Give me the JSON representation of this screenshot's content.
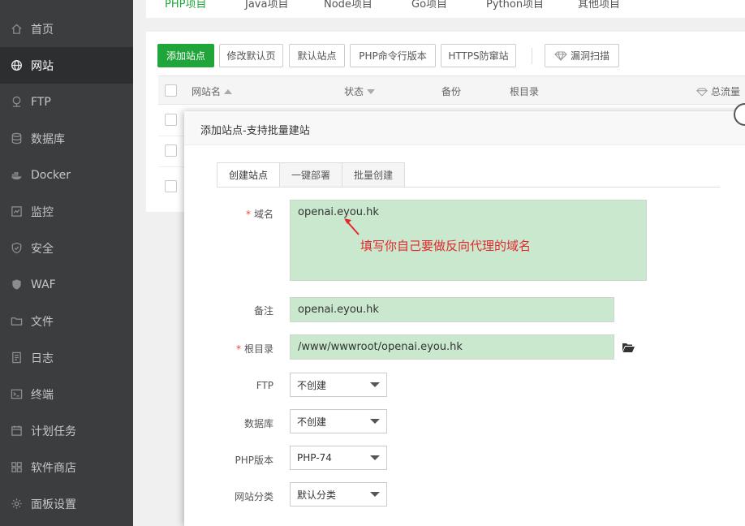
{
  "sidebar": {
    "items": [
      {
        "label": "首页",
        "icon": "home-icon"
      },
      {
        "label": "网站",
        "icon": "globe-icon",
        "active": true
      },
      {
        "label": "FTP",
        "icon": "ftp-icon"
      },
      {
        "label": "数据库",
        "icon": "database-icon"
      },
      {
        "label": "Docker",
        "icon": "docker-icon"
      },
      {
        "label": "监控",
        "icon": "monitor-icon"
      },
      {
        "label": "安全",
        "icon": "shield-icon"
      },
      {
        "label": "WAF",
        "icon": "waf-shield-icon"
      },
      {
        "label": "文件",
        "icon": "folder-icon"
      },
      {
        "label": "日志",
        "icon": "log-icon"
      },
      {
        "label": "终端",
        "icon": "terminal-icon"
      },
      {
        "label": "计划任务",
        "icon": "calendar-icon"
      },
      {
        "label": "软件商店",
        "icon": "grid-icon"
      },
      {
        "label": "面板设置",
        "icon": "gear-icon"
      }
    ]
  },
  "top_tabs": [
    "PHP项目",
    "Java项目",
    "Node项目",
    "Go项目",
    "Python项目",
    "其他项目"
  ],
  "toolbar": {
    "add_site": "添加站点",
    "edit_default_page": "修改默认页",
    "default_site": "默认站点",
    "php_cli_version": "PHP命令行版本",
    "https_protect": "HTTPS防窜站",
    "vuln_scan": "漏洞扫描"
  },
  "table": {
    "headers": {
      "site_name": "网站名",
      "status": "状态",
      "backup": "备份",
      "root_dir": "根目录",
      "total_traffic": "总流量"
    }
  },
  "modal": {
    "title": "添加站点-支持批量建站",
    "tabs": [
      "创建站点",
      "一键部署",
      "批量创建"
    ],
    "form": {
      "domain_label": "域名",
      "domain_value": "openai.eyou.hk",
      "remark_label": "备注",
      "remark_value": "openai.eyou.hk",
      "root_label": "根目录",
      "root_value": "/www/wwwroot/openai.eyou.hk",
      "ftp_label": "FTP",
      "ftp_value": "不创建",
      "db_label": "数据库",
      "db_value": "不创建",
      "php_label": "PHP版本",
      "php_value": "PHP-74",
      "category_label": "网站分类",
      "category_value": "默认分类"
    },
    "annotation": "填写你自己要做反向代理的域名"
  },
  "colors": {
    "accent": "#20a53a",
    "sidebar_bg": "#3b3d3f",
    "field_bg": "#c9e8cd",
    "annotation": "#e3262c"
  }
}
